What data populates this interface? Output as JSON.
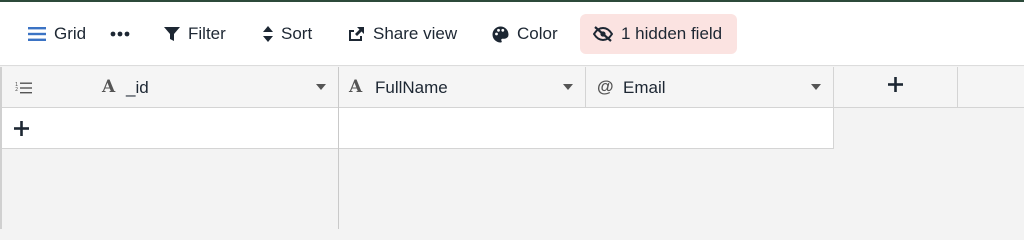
{
  "toolbar": {
    "grid_label": "Grid",
    "filter_label": "Filter",
    "sort_label": "Sort",
    "share_label": "Share view",
    "color_label": "Color",
    "hidden_label": "1 hidden field"
  },
  "columns": [
    {
      "name": "_id",
      "type_icon": "text-type-icon"
    },
    {
      "name": "FullName",
      "type_icon": "text-type-icon"
    },
    {
      "name": "Email",
      "type_icon": "at-sign-icon"
    }
  ],
  "colors": {
    "accent": "#3b73c4",
    "hidden_badge_bg": "#fbe3e1"
  }
}
